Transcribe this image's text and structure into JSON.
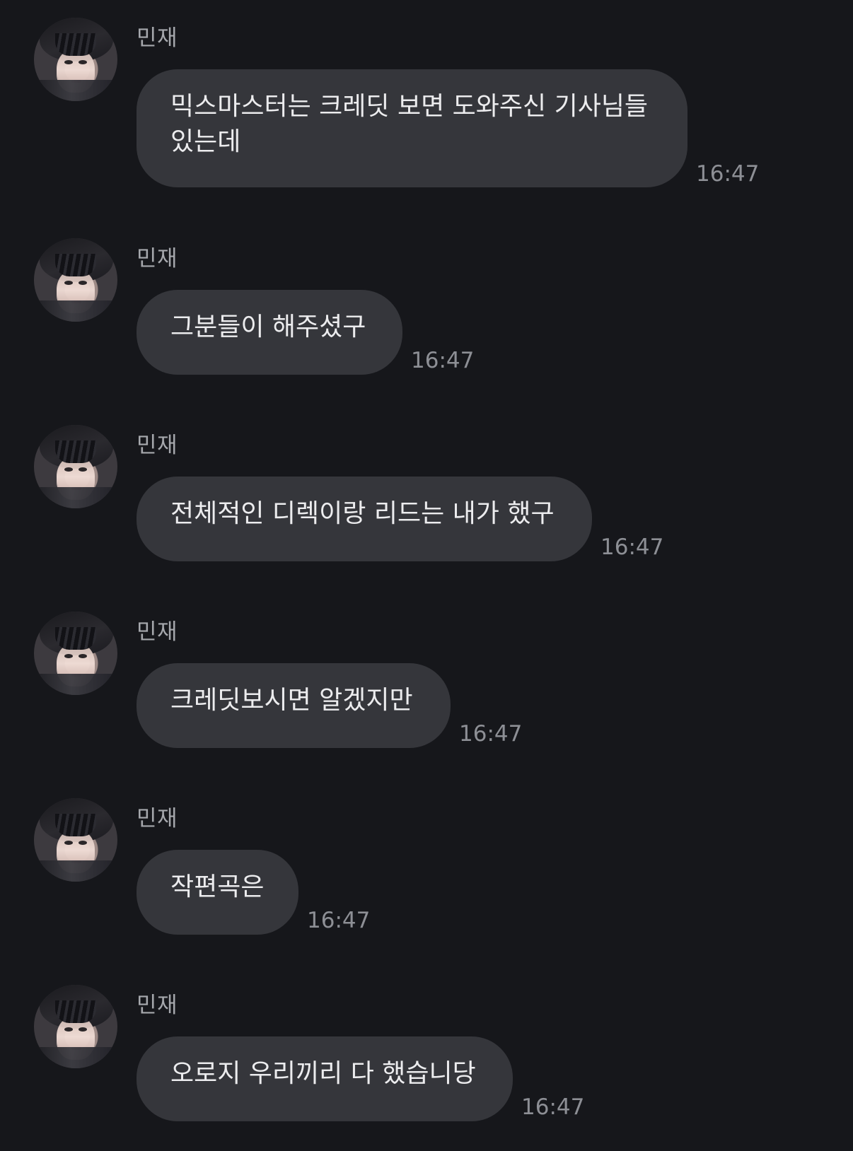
{
  "chat": {
    "messages": [
      {
        "sender": "민재",
        "text": "믹스마스터는 크레딧 보면 도와주신 기사님들 있는데",
        "time": "16:47"
      },
      {
        "sender": "민재",
        "text": "그분들이 해주셨구",
        "time": "16:47"
      },
      {
        "sender": "민재",
        "text": "전체적인 디렉이랑 리드는 내가 했구",
        "time": "16:47"
      },
      {
        "sender": "민재",
        "text": "크레딧보시면 알겠지만",
        "time": "16:47"
      },
      {
        "sender": "민재",
        "text": "작편곡은",
        "time": "16:47"
      },
      {
        "sender": "민재",
        "text": "오로지 우리끼리 다 했습니당",
        "time": "16:47"
      }
    ]
  }
}
